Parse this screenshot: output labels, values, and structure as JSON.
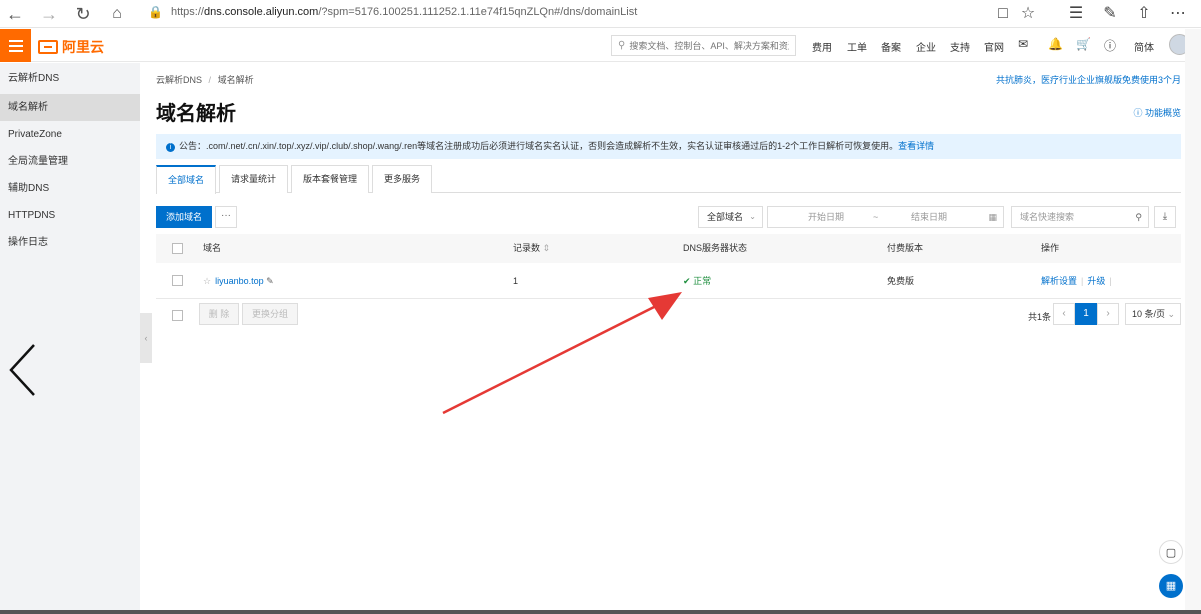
{
  "browser": {
    "url_prefix": "https://",
    "url_host": "dns.console.aliyun.com",
    "url_rest": "/?spm=5176.100251.111252.1.11e74f15qnZLQn#/dns/domainList"
  },
  "topbar": {
    "logo": "阿里云",
    "search_placeholder": "搜索文档、控制台、API、解决方案和资源",
    "nav": [
      "费用",
      "工单",
      "备案",
      "企业",
      "支持",
      "官网"
    ],
    "lang": "简体"
  },
  "sidebar": {
    "title": "云解析DNS",
    "items": [
      {
        "label": "域名解析"
      },
      {
        "label": "PrivateZone"
      },
      {
        "label": "全局流量管理"
      },
      {
        "label": "辅助DNS"
      },
      {
        "label": "HTTPDNS"
      },
      {
        "label": "操作日志"
      }
    ]
  },
  "main": {
    "breadcrumb": [
      "云解析DNS",
      "/",
      "域名解析"
    ],
    "promo": "共抗肺炎，医疗行业企业旗舰版免费使用3个月",
    "title": "域名解析",
    "help": "功能概览",
    "notice_prefix": "公告：",
    "notice_text": ".com/.net/.cn/.xin/.top/.xyz/.vip/.club/.shop/.wang/.ren等域名注册成功后必须进行域名实名认证，否则会造成解析不生效，实名认证审核通过后的1-2个工作日解析可恢复使用。",
    "notice_link": "查看详情",
    "tabs": [
      "全部域名",
      "请求量统计",
      "版本套餐管理",
      "更多服务"
    ],
    "add_button": "添加域名",
    "more_button": "···",
    "filter_select": "全部域名",
    "date_start": "开始日期",
    "date_sep": "~",
    "date_end": "结束日期",
    "search_placeholder": "域名快速搜索",
    "columns": [
      "域名",
      "记录数",
      "DNS服务器状态",
      "付费版本",
      "操作"
    ],
    "rows": [
      {
        "domain": "liyuanbo.top",
        "records": "1",
        "status": "正常",
        "plan": "免费版",
        "action1": "解析设置",
        "action2": "升级"
      }
    ],
    "delete_button": "删 除",
    "change_group_button": "更换分组",
    "pager_total": "共1条",
    "pager_current": "1",
    "pager_size": "10 条/页"
  },
  "colors": {
    "brand": "#ff6a00",
    "primary": "#0070cc",
    "ok": "#1e8e3e",
    "annotation": "#e53935"
  }
}
